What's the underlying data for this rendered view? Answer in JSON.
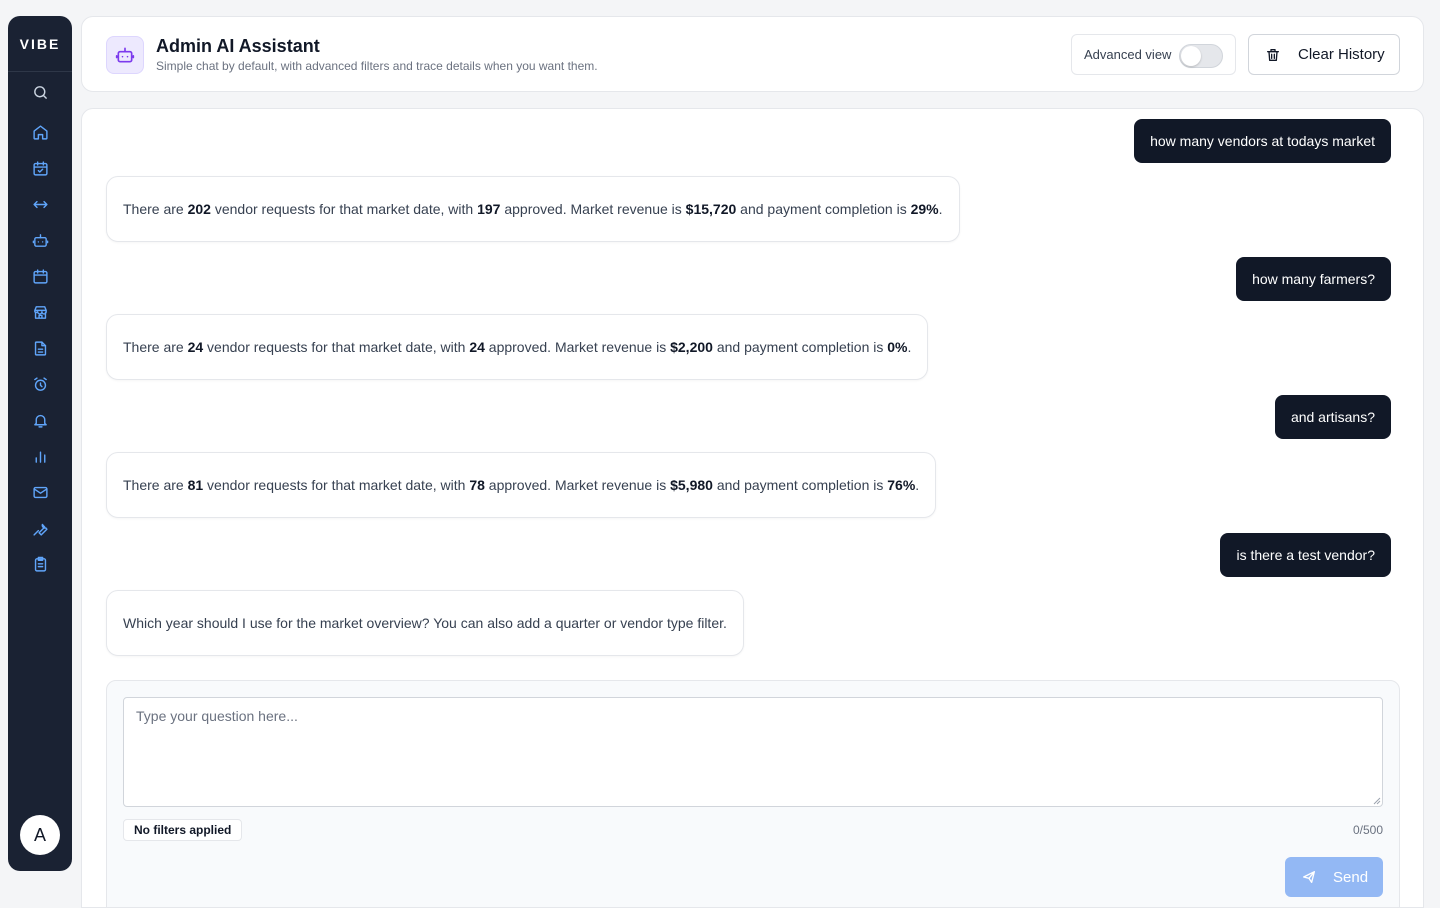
{
  "sidebar": {
    "logo": "VIBE",
    "nav_items": [
      "search-icon",
      "home-icon",
      "calendar-check-icon",
      "arrows-horizontal-icon",
      "robot-icon",
      "calendar-icon",
      "store-icon",
      "file-text-icon",
      "alarm-clock-icon",
      "bell-icon",
      "bar-chart-icon",
      "mail-icon",
      "wrench-icon",
      "clipboard-list-icon"
    ],
    "avatar_initial": "A"
  },
  "header": {
    "icon": "robot-icon",
    "title": "Admin AI Assistant",
    "subtitle": "Simple chat by default, with advanced filters and trace details when you want them.",
    "advanced_label": "Advanced view",
    "advanced_enabled": false,
    "clear_label": "Clear History"
  },
  "chat": {
    "messages": [
      {
        "role": "user",
        "text": "how many vendors at todays market"
      },
      {
        "role": "assistant",
        "pre": "There are ",
        "requests": "202",
        "mid1": " vendor requests for that market date, with ",
        "approved": "197",
        "mid2": " approved. Market revenue is ",
        "revenue": "$15,720",
        "mid3": " and payment completion is ",
        "completion": "29%",
        "end": "."
      },
      {
        "role": "user",
        "text": "how many farmers?"
      },
      {
        "role": "assistant",
        "pre": "There are ",
        "requests": "24",
        "mid1": " vendor requests for that market date, with ",
        "approved": "24",
        "mid2": " approved. Market revenue is ",
        "revenue": "$2,200",
        "mid3": " and payment completion is ",
        "completion": "0%",
        "end": "."
      },
      {
        "role": "user",
        "text": "and artisans?"
      },
      {
        "role": "assistant",
        "pre": "There are ",
        "requests": "81",
        "mid1": " vendor requests for that market date, with ",
        "approved": "78",
        "mid2": " approved. Market revenue is ",
        "revenue": "$5,980",
        "mid3": " and payment completion is ",
        "completion": "76%",
        "end": "."
      },
      {
        "role": "user",
        "text": "is there a test vendor?"
      },
      {
        "role": "assistant",
        "text": "Which year should I use for the market overview? You can also add a quarter or vendor type filter."
      }
    ]
  },
  "composer": {
    "placeholder": "Type your question here...",
    "value": "",
    "filters_label": "No filters applied",
    "char_count": "0/500",
    "send_label": "Send"
  },
  "colors": {
    "sidebar_bg": "#1a2233",
    "nav_icon": "#60a5fa",
    "user_bubble": "#111827",
    "send_button": "#93b8f4",
    "header_icon_bg": "#ede9fe"
  }
}
